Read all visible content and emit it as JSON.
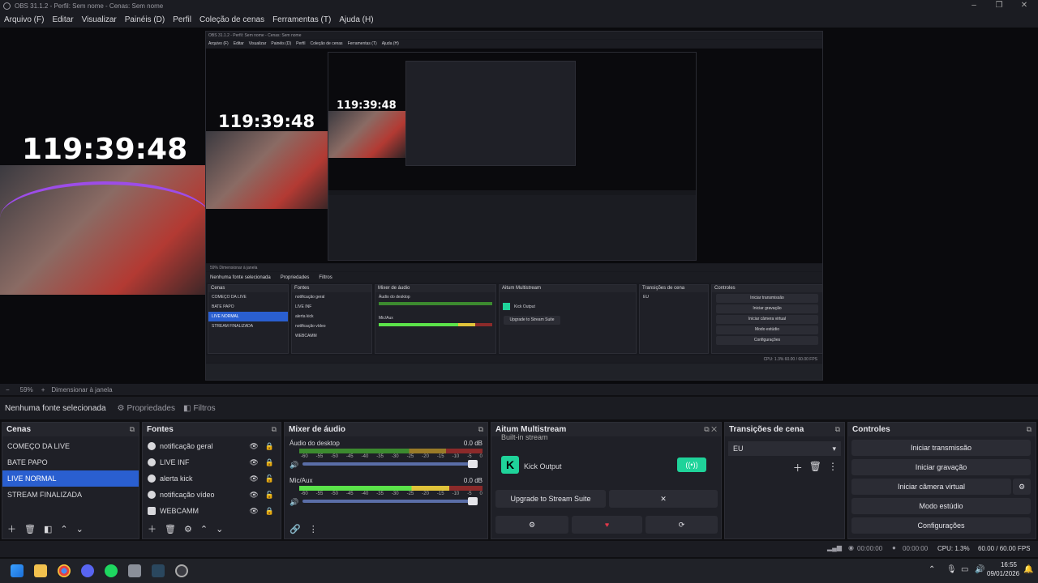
{
  "window": {
    "title": "OBS 31.1.2 - Perfil: Sem nome - Cenas: Sem nome"
  },
  "menu": [
    "Arquivo (F)",
    "Editar",
    "Visualizar",
    "Painéis (D)",
    "Perfil",
    "Coleção de cenas",
    "Ferramentas (T)",
    "Ajuda (H)"
  ],
  "preview": {
    "clock": "119:39:48",
    "nested_clock_1": "119:39:48",
    "nested_clock_2": "119:39:48",
    "nested_title": "OBS 31.1.2 - Perfil: Sem nome - Cenas: Sem nome",
    "nested_menu": [
      "Arquivo (F)",
      "Editar",
      "Visualizar",
      "Painéis (D)",
      "Perfil",
      "Coleção de cenas",
      "Ferramentas (T)",
      "Ajuda (H)"
    ],
    "nested_status": "59%   Dimensionar à janela",
    "nested_nosrc": "Nenhuma fonte selecionada",
    "nested_props": "Propriedades",
    "nested_filters": "Filtros",
    "nested_docks": [
      "Cenas",
      "Fontes",
      "Mixer de áudio",
      "Aitum Multistream",
      "Transições de cena",
      "Controles"
    ],
    "nested_scenes": [
      "COMEÇO DA LIVE",
      "BATE PAPO",
      "LIVE NORMAL",
      "STREAM FINALIZADA"
    ],
    "nested_sources": [
      "notificação geral",
      "LIVE INF",
      "alerta kick",
      "notificação vídeo",
      "WEBCAMM"
    ],
    "nested_controls": [
      "Iniciar transmissão",
      "Iniciar gravação",
      "Iniciar câmera virtual",
      "Modo estúdio",
      "Configurações"
    ],
    "nested_audio": [
      "Áudio do desktop",
      "Mic/Aux"
    ],
    "nested_kick": "Kick Output",
    "nested_upgrade": "Upgrade to Stream Suite",
    "nested_trans": "EU",
    "nested_fps": "CPU: 1.3%   60.00 / 60.00 FPS"
  },
  "zoom": {
    "minus": "−",
    "value": "59%",
    "plus": "+",
    "mode": "Dimensionar à janela"
  },
  "sourcebar": {
    "none": "Nenhuma fonte selecionada",
    "properties": "Propriedades",
    "filters": "Filtros"
  },
  "scenes": {
    "title": "Cenas",
    "items": [
      "COMEÇO DA LIVE",
      "BATE PAPO",
      "LIVE NORMAL",
      "STREAM FINALIZADA"
    ],
    "selected": 2
  },
  "sources": {
    "title": "Fontes",
    "items": [
      "notificação geral",
      "LIVE INF",
      "alerta kick",
      "notificação vídeo",
      "WEBCAMM"
    ]
  },
  "mixer": {
    "title": "Mixer de áudio",
    "channels": [
      {
        "name": "Áudio do desktop",
        "db": "0.0 dB",
        "level": 0.0
      },
      {
        "name": "Mic/Aux",
        "db": "0.0 dB",
        "level": 0.82
      }
    ],
    "ticks": [
      "-60",
      "-55",
      "-50",
      "-45",
      "-40",
      "-35",
      "-30",
      "-25",
      "-20",
      "-15",
      "-10",
      "-5",
      "0"
    ]
  },
  "aitum": {
    "title": "Aitum Multistream",
    "built_in": "Built-in stream",
    "kick": "Kick Output",
    "upgrade": "Upgrade to Stream Suite",
    "close": "✕"
  },
  "transitions": {
    "title": "Transições de cena",
    "selected": "EU"
  },
  "controls": {
    "title": "Controles",
    "buttons": [
      "Iniciar transmissão",
      "Iniciar gravação",
      "Iniciar câmera virtual",
      "Modo estúdio",
      "Configurações"
    ]
  },
  "status": {
    "rec_time": "00:00:00",
    "stream_time": "00:00:00",
    "cpu": "CPU: 1.3%",
    "fps": "60.00 / 60.00 FPS"
  },
  "clock": {
    "time": "16:55",
    "date": "09/01/2026"
  },
  "colors": {
    "accent": "#2a5fd0",
    "kick": "#1fd39a",
    "bg": "#1f2027",
    "heart": "#e0384a"
  }
}
